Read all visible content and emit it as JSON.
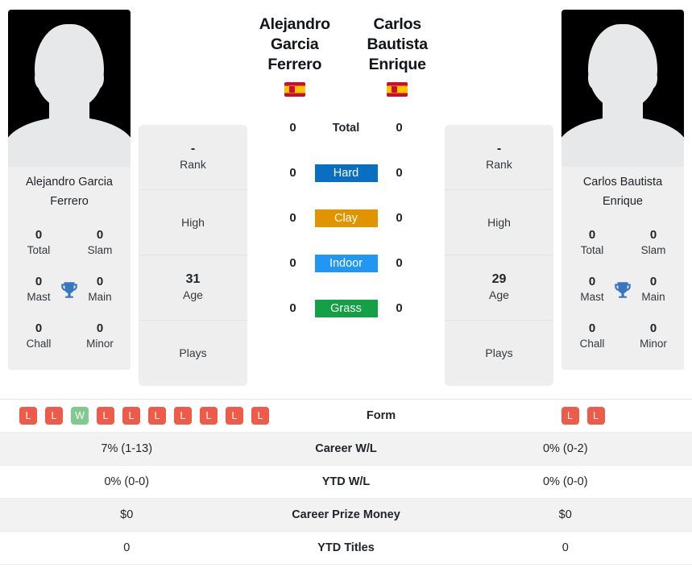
{
  "players": {
    "left": {
      "name_lines": [
        "Alejandro",
        "Garcia Ferrero"
      ],
      "full_name": "Alejandro Garcia Ferrero",
      "caption": "Alejandro\nGarcia Ferrero",
      "country_flag": "spain-flag",
      "rank": "-",
      "rank_label": "Rank",
      "high": "",
      "high_label": "High",
      "age": "31",
      "age_label": "Age",
      "plays": "",
      "plays_label": "Plays",
      "titles": {
        "total": "0",
        "total_label": "Total",
        "slam": "0",
        "slam_label": "Slam",
        "mast": "0",
        "mast_label": "Mast",
        "main": "0",
        "main_label": "Main",
        "chall": "0",
        "chall_label": "Chall",
        "minor": "0",
        "minor_label": "Minor"
      },
      "surface_counts": {
        "total": "0",
        "hard": "0",
        "clay": "0",
        "indoor": "0",
        "grass": "0"
      },
      "form": [
        "L",
        "L",
        "W",
        "L",
        "L",
        "L",
        "L",
        "L",
        "L",
        "L"
      ],
      "career_wl": "7% (1-13)",
      "ytd_wl": "0% (0-0)",
      "career_prize_money": "$0",
      "ytd_titles": "0"
    },
    "right": {
      "name_lines": [
        "Carlos Bautista",
        "Enrique"
      ],
      "full_name": "Carlos Bautista Enrique",
      "caption": "Carlos Bautista\nEnrique",
      "country_flag": "spain-flag",
      "rank": "-",
      "rank_label": "Rank",
      "high": "",
      "high_label": "High",
      "age": "29",
      "age_label": "Age",
      "plays": "",
      "plays_label": "Plays",
      "titles": {
        "total": "0",
        "total_label": "Total",
        "slam": "0",
        "slam_label": "Slam",
        "mast": "0",
        "mast_label": "Mast",
        "main": "0",
        "main_label": "Main",
        "chall": "0",
        "chall_label": "Chall",
        "minor": "0",
        "minor_label": "Minor"
      },
      "surface_counts": {
        "total": "0",
        "hard": "0",
        "clay": "0",
        "indoor": "0",
        "grass": "0"
      },
      "form": [
        "L",
        "L"
      ],
      "career_wl": "0% (0-2)",
      "ytd_wl": "0% (0-0)",
      "career_prize_money": "$0",
      "ytd_titles": "0"
    }
  },
  "surfaces": [
    {
      "key": "total",
      "label": "Total",
      "color": "transparent",
      "plain": true
    },
    {
      "key": "hard",
      "label": "Hard",
      "color": "#0a6fc2",
      "plain": false
    },
    {
      "key": "clay",
      "label": "Clay",
      "color": "#e09400",
      "plain": false
    },
    {
      "key": "indoor",
      "label": "Indoor",
      "color": "#2196f3",
      "plain": false
    },
    {
      "key": "grass",
      "label": "Grass",
      "color": "#13a046",
      "plain": false
    }
  ],
  "table": {
    "rows": [
      {
        "label": "Form",
        "type": "form"
      },
      {
        "label": "Career W/L",
        "type": "text",
        "key": "career_wl"
      },
      {
        "label": "YTD W/L",
        "type": "text",
        "key": "ytd_wl"
      },
      {
        "label": "Career Prize Money",
        "type": "text",
        "key": "career_prize_money"
      },
      {
        "label": "YTD Titles",
        "type": "text",
        "key": "ytd_titles"
      }
    ]
  },
  "colors": {
    "win": "#7fca8c",
    "loss": "#ee5b48",
    "trophy": "#3876c0",
    "card_bg": "#eeeeee",
    "row_alt": "#f2f2f2"
  }
}
